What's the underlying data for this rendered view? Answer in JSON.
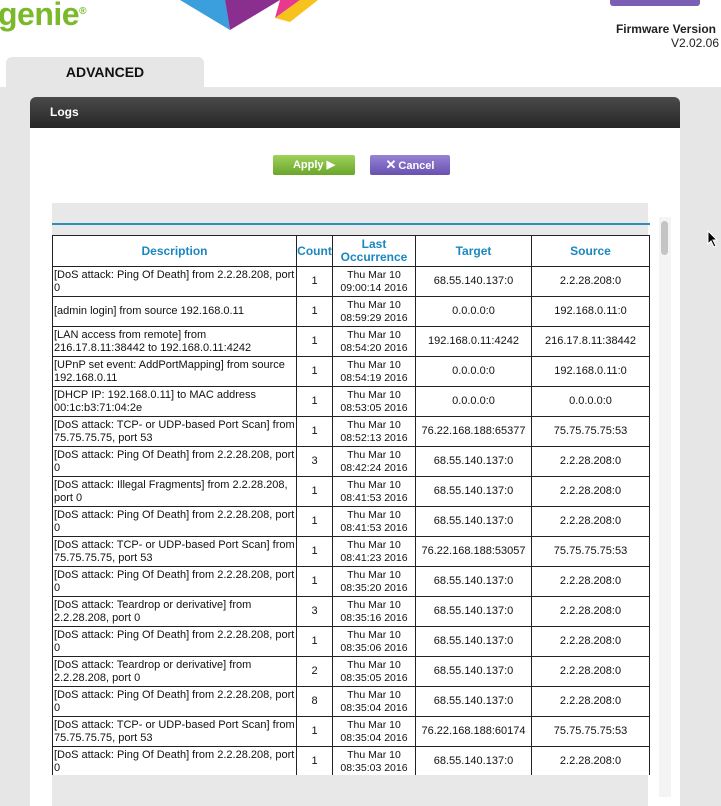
{
  "header": {
    "logo_text": "genie",
    "logo_mark": "®",
    "firmware_label": "Firmware Version",
    "firmware_value": "V2.02.06"
  },
  "nav": {
    "tab_label": "ADVANCED"
  },
  "panel": {
    "title": "Logs",
    "apply_label": "Apply",
    "cancel_label": "Cancel"
  },
  "colors": {
    "accent_green": "#7ab929",
    "accent_purple": "#6850b0",
    "header_blue": "#1a87c0"
  },
  "table": {
    "columns": [
      "Description",
      "Count",
      "Last Occurrence",
      "Target",
      "Source"
    ],
    "rows": [
      {
        "description": "[DoS attack: Ping Of Death] from 2.2.28.208, port 0",
        "count": "1",
        "time_day": "Thu Mar 10",
        "time_clock": "09:00:14 2016",
        "target": "68.55.140.137:0",
        "source": "2.2.28.208:0"
      },
      {
        "description": "[admin login] from source 192.168.0.11",
        "count": "1",
        "time_day": "Thu Mar 10",
        "time_clock": "08:59:29 2016",
        "target": "0.0.0.0:0",
        "source": "192.168.0.11:0"
      },
      {
        "description": "[LAN access from remote] from 216.17.8.11:38442 to 192.168.0.11:4242",
        "count": "1",
        "time_day": "Thu Mar 10",
        "time_clock": "08:54:20 2016",
        "target": "192.168.0.11:4242",
        "source": "216.17.8.11:38442"
      },
      {
        "description": "[UPnP set event: AddPortMapping] from source 192.168.0.11",
        "count": "1",
        "time_day": "Thu Mar 10",
        "time_clock": "08:54:19 2016",
        "target": "0.0.0.0:0",
        "source": "192.168.0.11:0"
      },
      {
        "description": "[DHCP IP: 192.168.0.11] to MAC address 00:1c:b3:71:04:2e",
        "count": "1",
        "time_day": "Thu Mar 10",
        "time_clock": "08:53:05 2016",
        "target": "0.0.0.0:0",
        "source": "0.0.0.0:0"
      },
      {
        "description": "[DoS attack: TCP- or UDP-based Port Scan] from 75.75.75.75, port 53",
        "count": "1",
        "time_day": "Thu Mar 10",
        "time_clock": "08:52:13 2016",
        "target": "76.22.168.188:65377",
        "source": "75.75.75.75:53"
      },
      {
        "description": "[DoS attack: Ping Of Death] from 2.2.28.208, port 0",
        "count": "3",
        "time_day": "Thu Mar 10",
        "time_clock": "08:42:24 2016",
        "target": "68.55.140.137:0",
        "source": "2.2.28.208:0"
      },
      {
        "description": "[DoS attack: Illegal Fragments] from 2.2.28.208, port 0",
        "count": "1",
        "time_day": "Thu Mar 10",
        "time_clock": "08:41:53 2016",
        "target": "68.55.140.137:0",
        "source": "2.2.28.208:0"
      },
      {
        "description": "[DoS attack: Ping Of Death] from 2.2.28.208, port 0",
        "count": "1",
        "time_day": "Thu Mar 10",
        "time_clock": "08:41:53 2016",
        "target": "68.55.140.137:0",
        "source": "2.2.28.208:0"
      },
      {
        "description": "[DoS attack: TCP- or UDP-based Port Scan] from 75.75.75.75, port 53",
        "count": "1",
        "time_day": "Thu Mar 10",
        "time_clock": "08:41:23 2016",
        "target": "76.22.168.188:53057",
        "source": "75.75.75.75:53"
      },
      {
        "description": "[DoS attack: Ping Of Death] from 2.2.28.208, port 0",
        "count": "1",
        "time_day": "Thu Mar 10",
        "time_clock": "08:35:20 2016",
        "target": "68.55.140.137:0",
        "source": "2.2.28.208:0"
      },
      {
        "description": "[DoS attack: Teardrop or derivative] from 2.2.28.208, port 0",
        "count": "3",
        "time_day": "Thu Mar 10",
        "time_clock": "08:35:16 2016",
        "target": "68.55.140.137:0",
        "source": "2.2.28.208:0"
      },
      {
        "description": "[DoS attack: Ping Of Death] from 2.2.28.208, port 0",
        "count": "1",
        "time_day": "Thu Mar 10",
        "time_clock": "08:35:06 2016",
        "target": "68.55.140.137:0",
        "source": "2.2.28.208:0"
      },
      {
        "description": "[DoS attack: Teardrop or derivative] from 2.2.28.208, port 0",
        "count": "2",
        "time_day": "Thu Mar 10",
        "time_clock": "08:35:05 2016",
        "target": "68.55.140.137:0",
        "source": "2.2.28.208:0"
      },
      {
        "description": "[DoS attack: Ping Of Death] from 2.2.28.208, port 0",
        "count": "8",
        "time_day": "Thu Mar 10",
        "time_clock": "08:35:04 2016",
        "target": "68.55.140.137:0",
        "source": "2.2.28.208:0"
      },
      {
        "description": "[DoS attack: TCP- or UDP-based Port Scan] from 75.75.75.75, port 53",
        "count": "1",
        "time_day": "Thu Mar 10",
        "time_clock": "08:35:04 2016",
        "target": "76.22.168.188:60174",
        "source": "75.75.75.75:53"
      },
      {
        "description": "[DoS attack: Ping Of Death] from 2.2.28.208, port 0",
        "count": "1",
        "time_day": "Thu Mar 10",
        "time_clock": "08:35:03 2016",
        "target": "68.55.140.137:0",
        "source": "2.2.28.208:0"
      }
    ]
  }
}
